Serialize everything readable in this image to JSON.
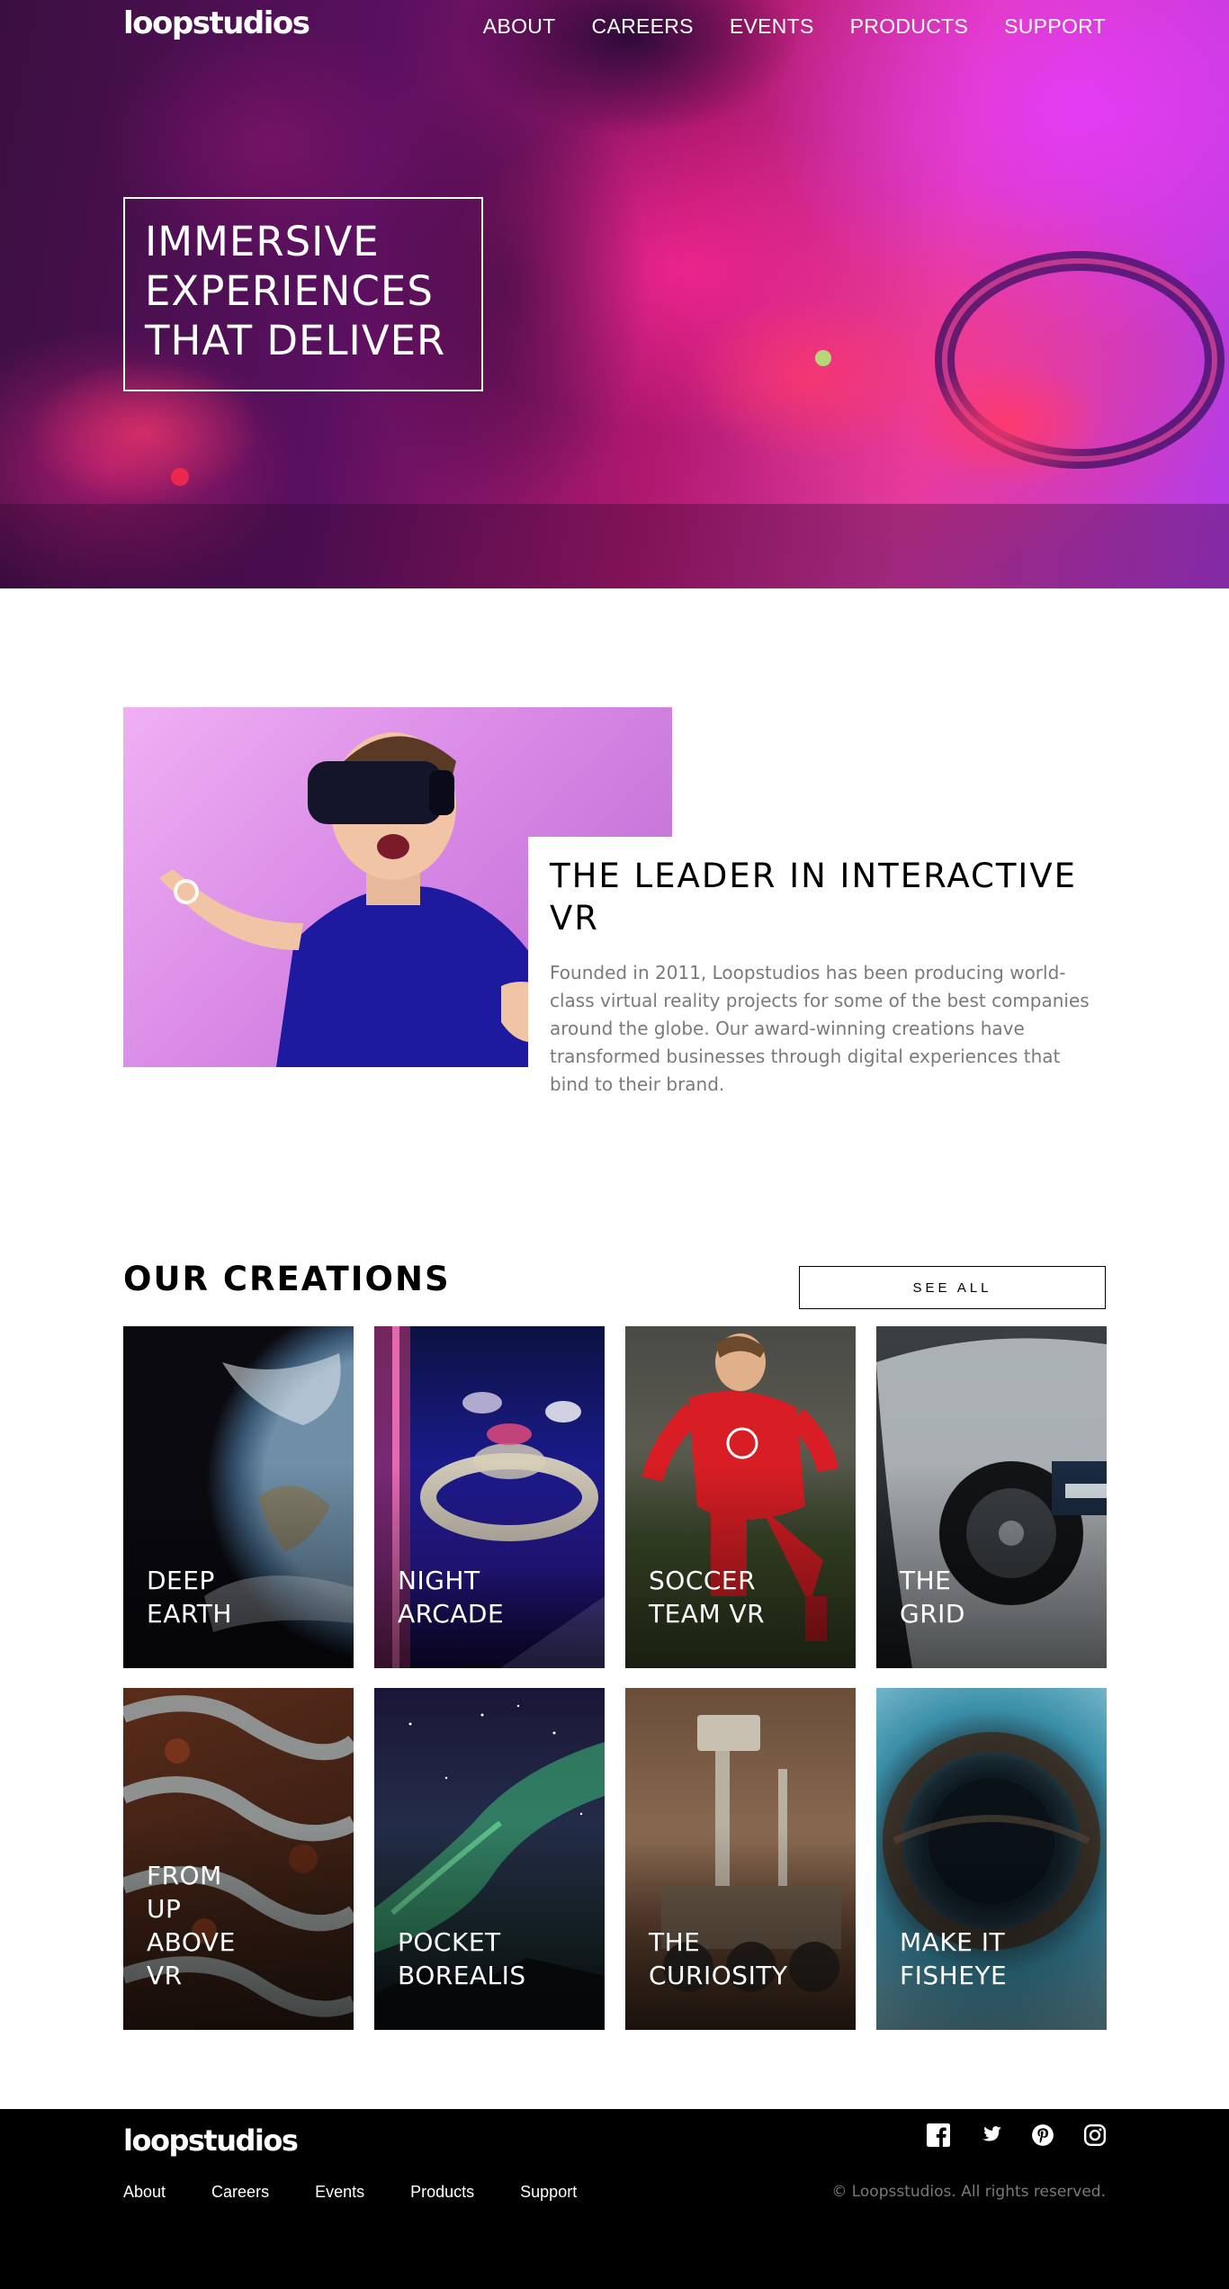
{
  "header": {
    "logo": "loopstudios",
    "nav": [
      {
        "label": "ABOUT"
      },
      {
        "label": "CAREERS"
      },
      {
        "label": "EVENTS"
      },
      {
        "label": "PRODUCTS"
      },
      {
        "label": "SUPPORT"
      }
    ]
  },
  "hero": {
    "title": "IMMERSIVE EXPERIENCES THAT DELIVER"
  },
  "intro": {
    "title": "THE LEADER IN INTERACTIVE VR",
    "text": "Founded in 2011, Loopstudios has been producing world-class virtual reality projects for some of the best companies around the globe. Our award-winning creations have transformed businesses through digital experiences that bind to their brand."
  },
  "creations": {
    "title": "OUR CREATIONS",
    "see_all_label": "SEE ALL",
    "items": [
      {
        "label": "DEEP\nEARTH"
      },
      {
        "label": "NIGHT\nARCADE"
      },
      {
        "label": "SOCCER\nTEAM VR"
      },
      {
        "label": "THE\nGRID"
      },
      {
        "label": "FROM\nUP\nABOVE\nVR"
      },
      {
        "label": "POCKET\nBOREALIS"
      },
      {
        "label": "THE\nCURIOSITY"
      },
      {
        "label": "MAKE IT\nFISHEYE"
      }
    ]
  },
  "footer": {
    "logo": "loopstudios",
    "nav": [
      {
        "label": "About"
      },
      {
        "label": "Careers"
      },
      {
        "label": "Events"
      },
      {
        "label": "Products"
      },
      {
        "label": "Support"
      }
    ],
    "social": [
      "facebook-icon",
      "twitter-icon",
      "pinterest-icon",
      "instagram-icon"
    ],
    "copyright": "© Loopsstudios. All rights reserved."
  }
}
